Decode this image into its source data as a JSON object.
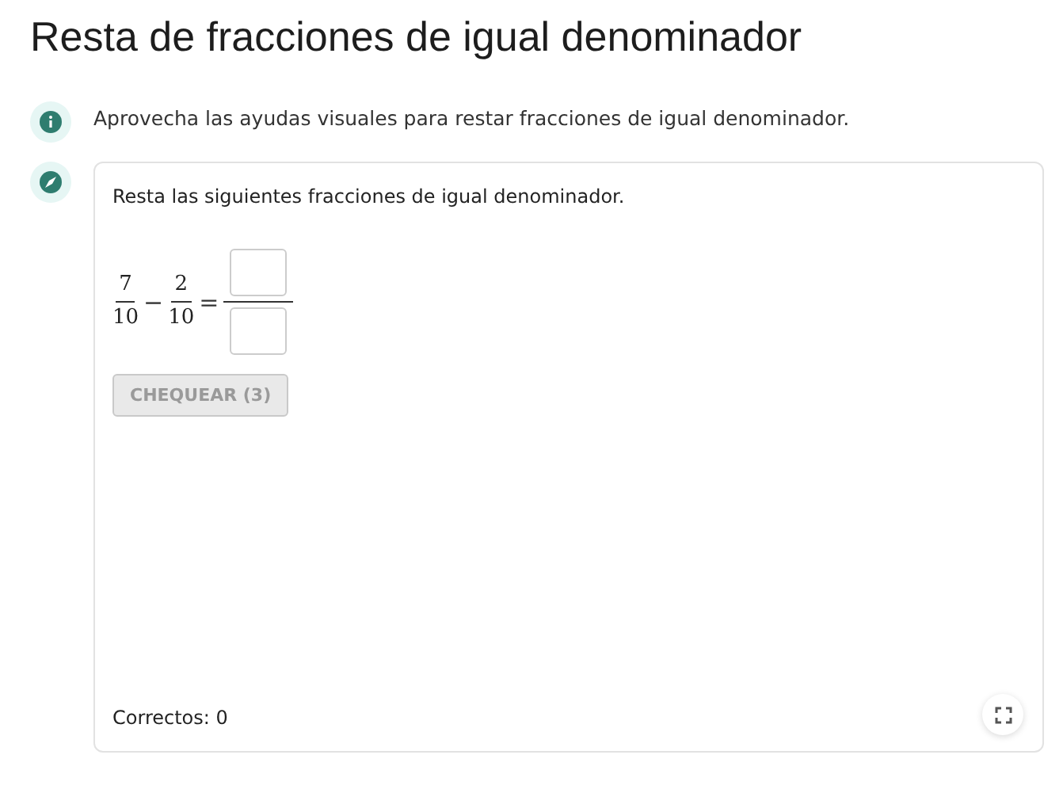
{
  "title": "Resta de fracciones de igual denominador",
  "tip": {
    "text": "Aprovecha las ayudas visuales para restar fracciones de igual denominador."
  },
  "exercise": {
    "instruction": "Resta las siguientes fracciones de igual denominador.",
    "expression": [
      {
        "kind": "fraction",
        "numerator": "7",
        "denominator": "10"
      },
      {
        "kind": "operator",
        "symbol": "−"
      },
      {
        "kind": "fraction",
        "numerator": "2",
        "denominator": "10"
      },
      {
        "kind": "operator",
        "symbol": "="
      },
      {
        "kind": "answer"
      }
    ],
    "check_button": {
      "label": "CHEQUEAR (3)",
      "disabled": true
    },
    "score": "Correctos: 0"
  }
}
